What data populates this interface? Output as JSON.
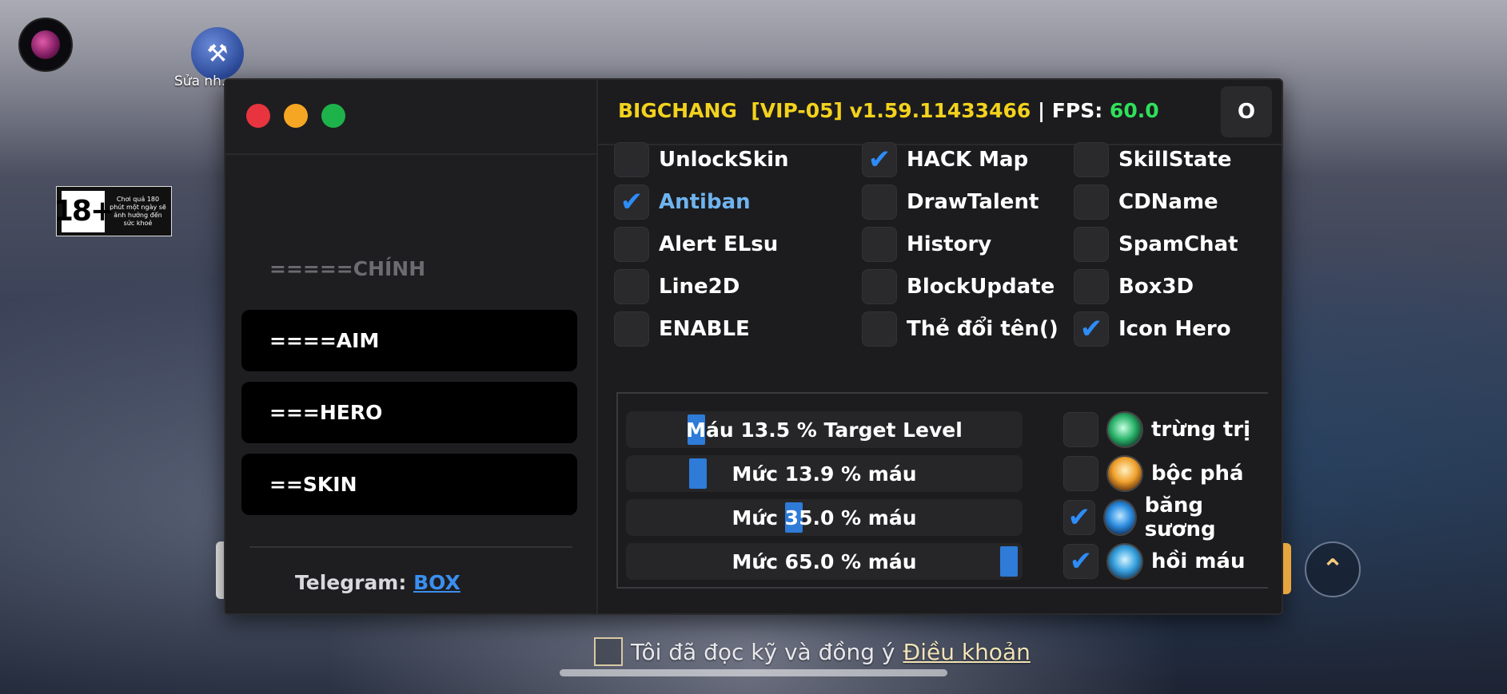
{
  "desktop": {
    "repair_label": "Sửa nh...",
    "age_badge": {
      "number": "18+",
      "note": "Chơi quá 180 phút một ngày sẽ ảnh hưởng đến sức khoẻ"
    }
  },
  "window": {
    "title_brand": "BIGCHANG",
    "title_vip": "[VIP-05] v1.59.11433466",
    "title_sep": " | FPS: ",
    "fps": "60.0",
    "close_label": "O"
  },
  "sidebar": {
    "header": "=====CHÍNH",
    "items": [
      {
        "label": "====AIM"
      },
      {
        "label": "===HERO"
      },
      {
        "label": "==SKIN"
      }
    ],
    "telegram_label": "Telegram:",
    "telegram_link": "BOX"
  },
  "options": {
    "col1": [
      {
        "label": "UnlockSkin",
        "checked": false
      },
      {
        "label": "Antiban",
        "checked": true
      },
      {
        "label": "Alert ELsu",
        "checked": false
      },
      {
        "label": "Line2D",
        "checked": false
      },
      {
        "label": "ENABLE",
        "checked": false
      }
    ],
    "col2": [
      {
        "label": "HACK Map",
        "checked": true
      },
      {
        "label": "DrawTalent",
        "checked": false
      },
      {
        "label": "History",
        "checked": false
      },
      {
        "label": "BlockUpdate",
        "checked": false
      },
      {
        "label": "Thẻ đổi tên()",
        "checked": false
      }
    ],
    "col3": [
      {
        "label": "SkillState",
        "checked": false
      },
      {
        "label": "CDName",
        "checked": false
      },
      {
        "label": "SpamChat",
        "checked": false
      },
      {
        "label": "Box3D",
        "checked": false
      },
      {
        "label": "Icon Hero",
        "checked": true
      }
    ]
  },
  "sliders": [
    {
      "label": "Máu 13.5 % Target Level",
      "value": 13.5
    },
    {
      "label": "Mức 13.9 % máu",
      "value": 13.9
    },
    {
      "label": "Mức 35.0 % máu",
      "value": 35.0
    },
    {
      "label": "Mức 65.0 % máu",
      "value": 65.0
    }
  ],
  "buffs": [
    {
      "label": "trừng trị",
      "checked": false,
      "icon": "punish-spell-icon"
    },
    {
      "label": "bộc phá",
      "checked": false,
      "icon": "burst-spell-icon"
    },
    {
      "label": "băng sương",
      "checked": true,
      "icon": "frost-spell-icon"
    },
    {
      "label": "hồi máu",
      "checked": true,
      "icon": "heal-spell-icon"
    }
  ],
  "footer": {
    "agree_text": "Tôi đã đọc kỹ và đồng ý",
    "agree_link": "Điều khoản"
  },
  "colors": {
    "accent": "#2e8cf6",
    "title_yellow": "#f3d21d",
    "fps_green": "#2fe05a"
  }
}
